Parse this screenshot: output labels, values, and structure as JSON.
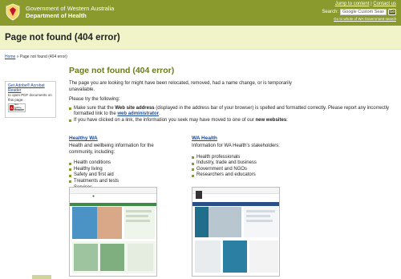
{
  "header": {
    "govt_line1": "Government of Western Australia",
    "govt_line2": "Department of Health",
    "jump_link": "Jump to content",
    "contact_link": "Contact us",
    "separator": "|",
    "search_label": "Search:",
    "search_value": "Google Custom Search",
    "search_button": "Go",
    "whole_govt_link": "Go to whole of WA Government search"
  },
  "title_band": {
    "title": "Page not found (404 error)"
  },
  "breadcrumb": {
    "home": "Home",
    "sep": " » ",
    "current": "Page not found (404 error)"
  },
  "sidebar": {
    "title": "Get Adobe® Acrobat Reader",
    "text": "to open PDF documents on this page.",
    "badge_line1": "Get Adobe",
    "badge_line2": "Reader"
  },
  "main": {
    "title": "Page not found (404 error)",
    "intro": "The page you are looking for might have been relocated, removed, had a name change, or is temporarily unavailable.",
    "try_label": "Please try the following:",
    "bullets": [
      {
        "pre": "Make sure that the ",
        "bold": "Web site address",
        "post": " (displayed in the address bar of your browser) is spelled and formatted correctly. Please report any incorrectly formatted link to the ",
        "link": "web administrator",
        "end": "."
      },
      {
        "pre": "If you have clicked on a link, the information you seek may have moved to one of our ",
        "bold": "new websites",
        "post": ":"
      }
    ]
  },
  "columns": {
    "left": {
      "heading": "Healthy WA",
      "desc": "Health and wellbeing information for the community, including:",
      "items": [
        "Health conditions",
        "Healthy living",
        "Safety and first aid",
        "Treatments and tests",
        "Services"
      ]
    },
    "right": {
      "heading": "WA Health",
      "desc": "Information for WA Health's stakeholders:",
      "items": [
        "Health professionals",
        "Industry, trade and business",
        "Government and NGOs",
        "Researchers and educators"
      ]
    }
  },
  "colors": {
    "header_green": "#8a9a2c",
    "band_yellow": "#f0f4c8",
    "link_blue": "#1a4a9a",
    "title_olive": "#6b7a1c"
  }
}
